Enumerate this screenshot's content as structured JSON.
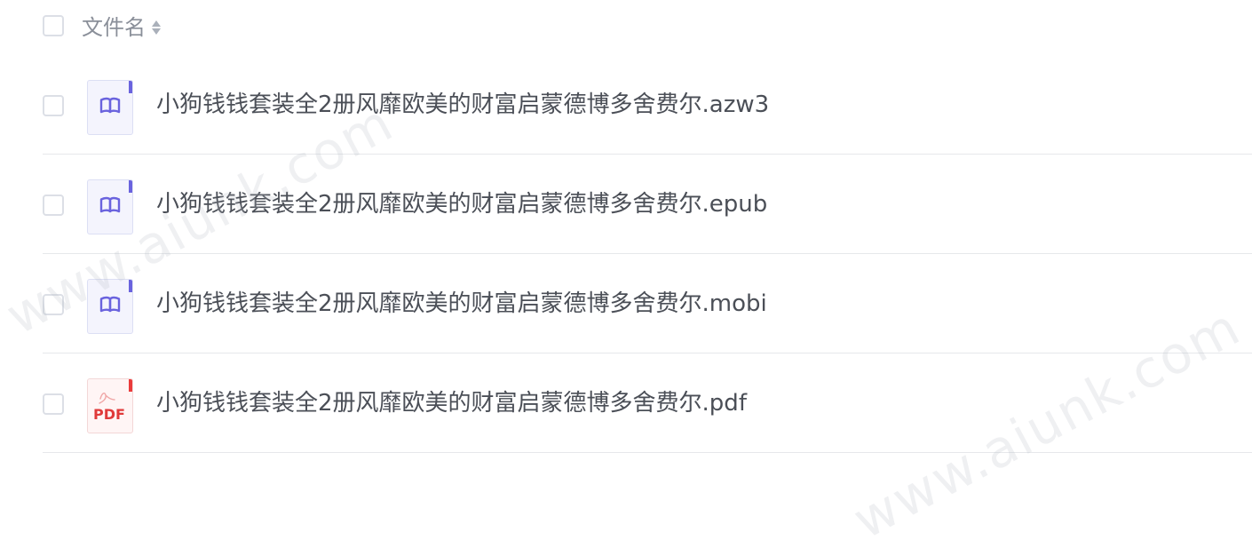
{
  "header": {
    "title": "文件名"
  },
  "files": [
    {
      "name": "小狗钱钱套装全2册风靡欧美的财富启蒙德博多舍费尔.azw3",
      "icon": "ebook-icon"
    },
    {
      "name": "小狗钱钱套装全2册风靡欧美的财富启蒙德博多舍费尔.epub",
      "icon": "ebook-icon"
    },
    {
      "name": "小狗钱钱套装全2册风靡欧美的财富启蒙德博多舍费尔.mobi",
      "icon": "ebook-icon"
    },
    {
      "name": "小狗钱钱套装全2册风靡欧美的财富启蒙德博多舍费尔.pdf",
      "icon": "pdf-icon",
      "badge": "PDF"
    }
  ],
  "watermarks": [
    "www.aiunk.com",
    "www.aiunk.com"
  ],
  "colors": {
    "ebook_accent": "#6a63de",
    "pdf_accent": "#ea3b3b",
    "text": "#4b4f57",
    "header_text": "#8a8f99",
    "divider": "#e6e8eb"
  }
}
